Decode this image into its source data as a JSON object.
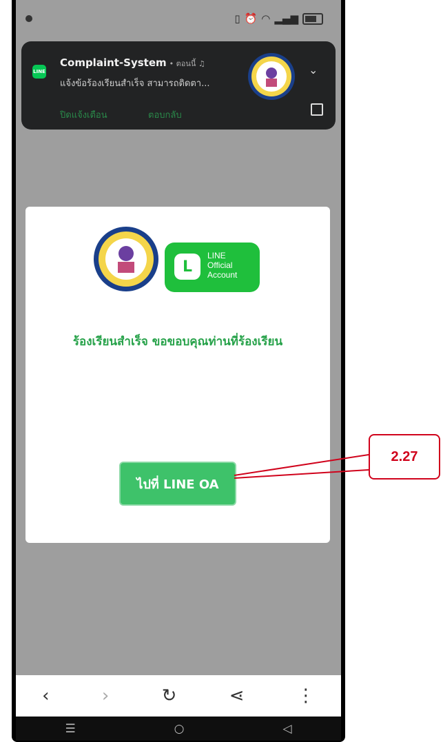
{
  "notification": {
    "app_name": "Complaint-System",
    "meta": "• ตอนนี้ ♫",
    "body": "แจ้งข้อร้องเรียนสำเร็จ สามารถติดตา...",
    "action_dismiss": "ปิดแจ้งเตือน",
    "action_reply": "ตอบกลับ",
    "app_icon_text": "LINE"
  },
  "card": {
    "line_badge_letter": "L",
    "line_badge_label": "LINE\nOfficial\nAccount",
    "message": "ร้องเรียนสำเร็จ ขอขอบคุณท่านที่ร้องเรียน",
    "button_label": "ไปที่ LINE OA"
  },
  "browser_nav": {
    "back": "‹",
    "forward": "›",
    "reload": "↻",
    "share": "⋖",
    "menu": "⋮"
  },
  "system_nav": {
    "recents": "☰",
    "home": "○",
    "back": "◁"
  },
  "annotation": {
    "label": "2.27"
  },
  "colors": {
    "line_green": "#1fbf3c",
    "message_green": "#27a24a",
    "button_green": "#3ec26a",
    "annotation_red": "#d0021b"
  }
}
